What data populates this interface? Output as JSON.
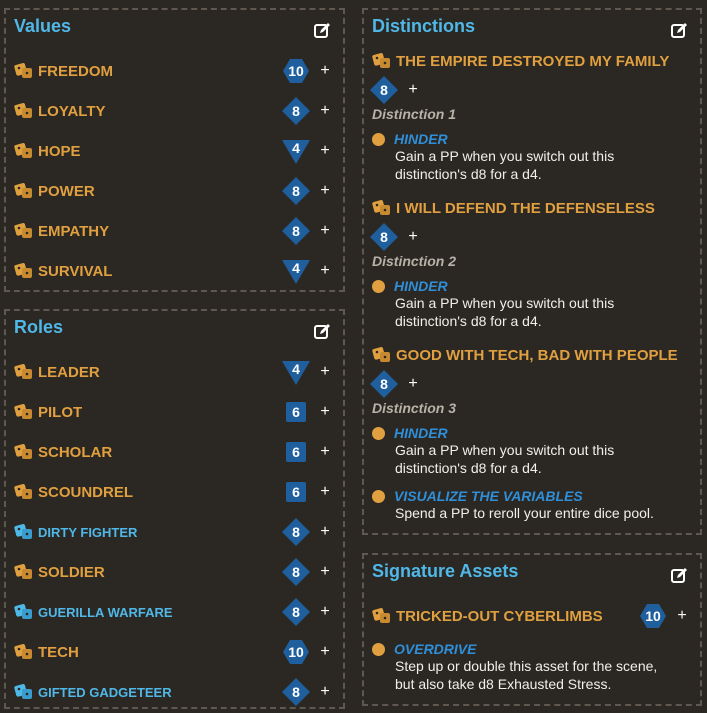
{
  "values": {
    "title": "Values",
    "edit_icon": "edit-icon",
    "items": [
      {
        "label": "FREEDOM",
        "die": "10"
      },
      {
        "label": "LOYALTY",
        "die": "8"
      },
      {
        "label": "HOPE",
        "die": "4"
      },
      {
        "label": "POWER",
        "die": "8"
      },
      {
        "label": "EMPATHY",
        "die": "8"
      },
      {
        "label": "SURVIVAL",
        "die": "4"
      }
    ]
  },
  "roles": {
    "title": "Roles",
    "edit_icon": "edit-icon",
    "items": [
      {
        "label": "LEADER",
        "die": "4"
      },
      {
        "label": "PILOT",
        "die": "6"
      },
      {
        "label": "SCHOLAR",
        "die": "6"
      },
      {
        "label": "SCOUNDREL",
        "die": "6"
      },
      {
        "label": "DIRTY FIGHTER",
        "die": "8"
      },
      {
        "label": "SOLDIER",
        "die": "8"
      },
      {
        "label": "GUERILLA WARFARE",
        "die": "8"
      },
      {
        "label": "TECH",
        "die": "10"
      },
      {
        "label": "GIFTED GADGETEER",
        "die": "8"
      }
    ]
  },
  "distinctions": {
    "title": "Distinctions",
    "edit_icon": "edit-icon",
    "items": [
      {
        "name": "THE EMPIRE DESTROYED MY FAMILY",
        "die": "8",
        "sub": "Distinction 1",
        "sfx_name": "HINDER",
        "sfx_text_1": "Gain a PP when you switch out this",
        "sfx_text_2": "distinction's d8 for a d4."
      },
      {
        "name": "I WILL DEFEND THE DEFENSELESS",
        "die": "8",
        "sub": "Distinction 2",
        "sfx_name": "HINDER",
        "sfx_text_1": "Gain a PP when you switch out this",
        "sfx_text_2": "distinction's d8 for a d4."
      },
      {
        "name": "GOOD WITH TECH, BAD WITH PEOPLE",
        "die": "8",
        "sub": "Distinction 3",
        "sfx_name": "HINDER",
        "sfx_text_1": "Gain a PP when you switch out this",
        "sfx_text_2": "distinction's d8 for a d4."
      }
    ],
    "extra_sfx": {
      "name": "VISUALIZE THE VARIABLES",
      "text": "Spend a PP to reroll your entire dice pool."
    }
  },
  "signature_assets": {
    "title": "Signature Assets",
    "edit_icon": "edit-icon",
    "asset": {
      "name": "TRICKED-OUT CYBERLIMBS",
      "die": "10"
    },
    "sfx": {
      "name": "OVERDRIVE",
      "text_1": "Step up or double this asset for the scene,",
      "text_2": "but also take d8 Exhausted Stress."
    }
  },
  "plus_label": "+",
  "colors": {
    "accent": "#4fb8e8",
    "trait": "#e0a040",
    "die": "#1f5f9e",
    "sfx": "#2f8fd8"
  }
}
